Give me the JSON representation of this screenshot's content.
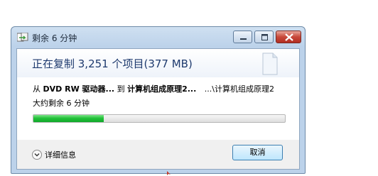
{
  "window": {
    "title": "剩余 6 分钟"
  },
  "header": {
    "title": "正在复制 3,251 个项目(377 MB)"
  },
  "transfer": {
    "from_prefix": "从",
    "source": "DVD RW 驱动器...",
    "to_word": "到",
    "destination_name": "计算机组成原理2...",
    "destination_path": "...\\计算机组成原理2",
    "time_remaining": "大约剩余 6 分钟",
    "progress_fraction": 0.28
  },
  "footer": {
    "details_label": "详细信息",
    "cancel_label": "取消"
  },
  "colors": {
    "progress": "#23c33a",
    "header_text": "#1e3a6e"
  },
  "icons": {
    "app": "copy-icon",
    "document": "document-icon",
    "details": "chevron-down-icon"
  }
}
